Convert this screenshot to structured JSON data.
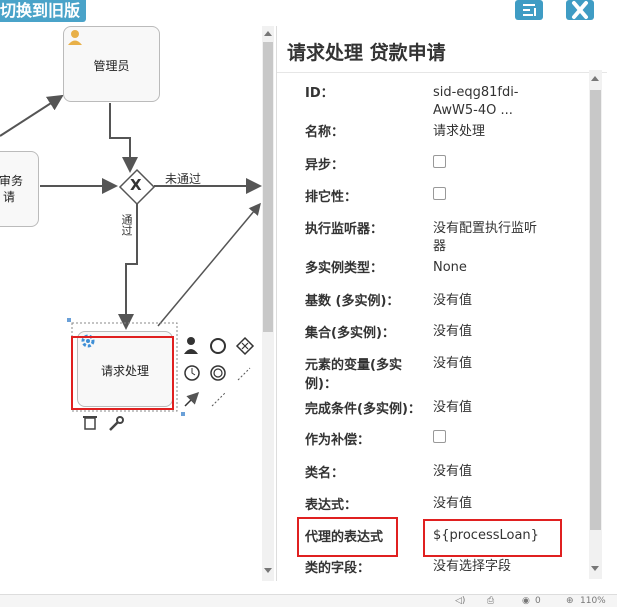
{
  "toolbar": {
    "switch_label": "切换到旧版",
    "layout_icon": "layout-icon",
    "close_icon": "close-icon"
  },
  "canvas": {
    "admin_label": "管理员",
    "left_node_line1": "审务",
    "left_node_line2": "请",
    "gateway_symbol": "X",
    "fail_label": "未通过",
    "pass_label": "通过",
    "request_label": "请求处理"
  },
  "props": {
    "title": "请求处理 贷款申请",
    "rows": [
      {
        "label": "ID：",
        "value": "sid-eqg81fdi-"
      },
      {
        "label": "名称：",
        "value": "请求处理"
      },
      {
        "label": "异步：",
        "value": ""
      },
      {
        "label": "排它性：",
        "value": ""
      },
      {
        "label": "执行监听器：",
        "value": "没有配置执行监听"
      },
      {
        "label": "多实例类型：",
        "value": "None"
      },
      {
        "label": "基数 (多实例)：",
        "value": "没有值"
      },
      {
        "label": "集合(多实例)：",
        "value": "没有值"
      },
      {
        "label": "元素的变量(多实",
        "value": "没有值"
      },
      {
        "label": "完成条件(多实例)：",
        "value": "没有值"
      },
      {
        "label": "作为补偿：",
        "value": ""
      },
      {
        "label": "类名：",
        "value": "没有值"
      },
      {
        "label": "表达式：",
        "value": "没有值"
      },
      {
        "label": "代理的表达式",
        "value": "${processLoan}"
      },
      {
        "label": "类的字段：",
        "value": "没有选择字段"
      }
    ],
    "id_line2": "AwW5-4O ...",
    "listener_line2": "器",
    "var_line2": "例)："
  },
  "status": {
    "zoom": "110%",
    "count": "0"
  },
  "colors": {
    "accent": "#3f9cc4",
    "highlight": "#e02020"
  }
}
